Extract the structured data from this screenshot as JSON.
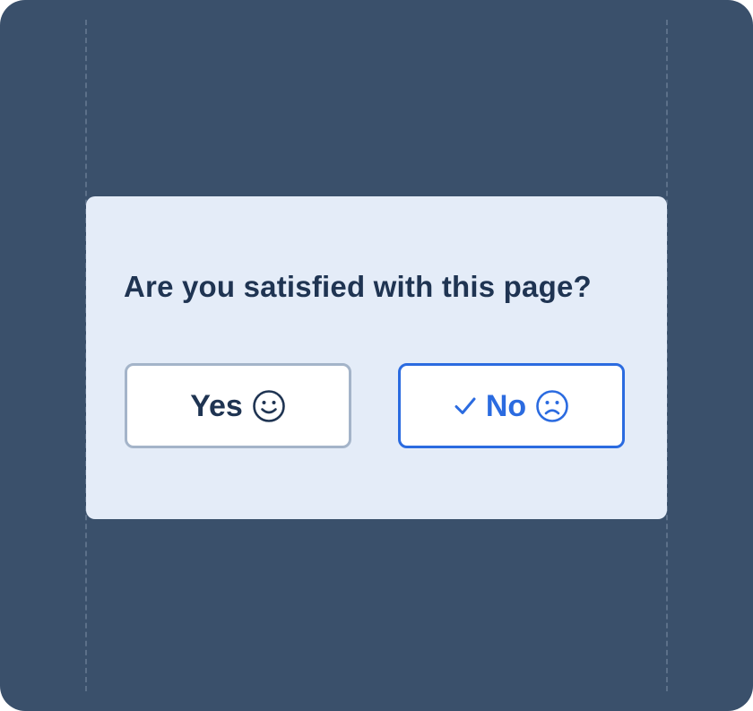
{
  "survey": {
    "question": "Are you satisfied with this page?",
    "yes_label": "Yes",
    "no_label": "No",
    "selected": "No"
  },
  "icons": {
    "yes": "smiley-face-icon",
    "no": "frowning-face-icon",
    "selected": "checkmark-icon"
  },
  "colors": {
    "background": "#3a506b",
    "card": "#e4ecf8",
    "text": "#1f3452",
    "accent": "#2b6be0",
    "unselected_border": "#a4b4c9"
  }
}
